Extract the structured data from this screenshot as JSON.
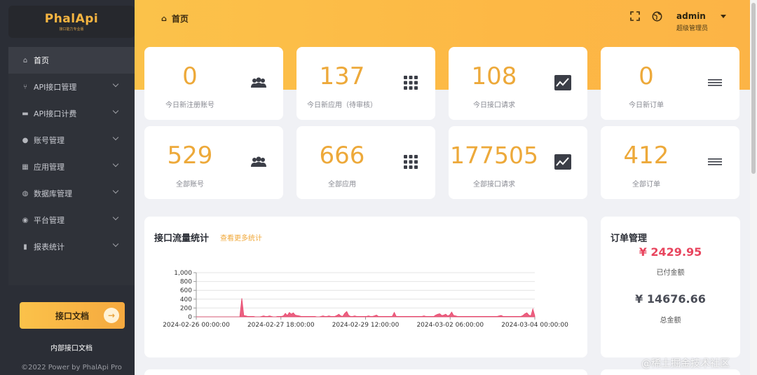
{
  "sidebar": {
    "logo": "PhalApi",
    "logo_sub": "接口能力专业版",
    "items": [
      {
        "label": "首页",
        "icon": "home-icon",
        "glyph": "⌂"
      },
      {
        "label": "API接口管理",
        "icon": "branch-icon",
        "glyph": "⑂"
      },
      {
        "label": "API接口计费",
        "icon": "card-icon",
        "glyph": "▬"
      },
      {
        "label": "账号管理",
        "icon": "user-icon",
        "glyph": "●"
      },
      {
        "label": "应用管理",
        "icon": "grid-icon",
        "glyph": "▦"
      },
      {
        "label": "数据库管理",
        "icon": "database-icon",
        "glyph": "◍"
      },
      {
        "label": "平台管理",
        "icon": "platform-icon",
        "glyph": "◉"
      },
      {
        "label": "报表统计",
        "icon": "barchart-icon",
        "glyph": "▮"
      }
    ],
    "doc_button": "接口文档",
    "internal_doc": "内部接口文档",
    "copyright": "©2022 Power by PhalApi Pro"
  },
  "header": {
    "breadcrumb": "首页",
    "user_name": "admin",
    "user_role": "超级管理员"
  },
  "stats_today": [
    {
      "value": "0",
      "label": "今日新注册账号",
      "icon": "users-icon"
    },
    {
      "value": "137",
      "label": "今日新应用（待审核）",
      "icon": "apps-grid-icon"
    },
    {
      "value": "108",
      "label": "今日接口请求",
      "icon": "trend-chart-icon"
    },
    {
      "value": "0",
      "label": "今日新订单",
      "icon": "list-lines-icon"
    }
  ],
  "stats_total": [
    {
      "value": "529",
      "label": "全部账号",
      "icon": "users-icon"
    },
    {
      "value": "666",
      "label": "全部应用",
      "icon": "apps-grid-icon"
    },
    {
      "value": "177505",
      "label": "全部接口请求",
      "icon": "trend-chart-icon"
    },
    {
      "value": "412",
      "label": "全部订单",
      "icon": "list-lines-icon"
    }
  ],
  "traffic": {
    "title": "接口流量统计",
    "more_link": "查看更多统计"
  },
  "orders": {
    "title": "订单管理",
    "paid_amount": "¥ 2429.95",
    "paid_label": "已付金额",
    "total_amount": "¥ 14676.66",
    "total_label": "总金额"
  },
  "watermark": "@稀土掘金技术社区",
  "chart_data": {
    "type": "area",
    "title": "",
    "xlabel": "",
    "ylabel": "",
    "ylim": [
      0,
      1000
    ],
    "y_ticks": [
      "0",
      "200",
      "400",
      "600",
      "800",
      "1,000"
    ],
    "x_ticks": [
      "2024-02-26 00:00:00",
      "2024-02-27 18:00:00",
      "2024-02-29 12:00:00",
      "2024-03-02 06:00:00",
      "2024-03-04 00:00:00"
    ],
    "series_color": "#e8456b",
    "values": [
      0,
      0,
      0,
      0,
      0,
      0,
      0,
      0,
      0,
      0,
      0,
      0,
      0,
      0,
      0,
      0,
      0,
      0,
      0,
      0,
      0,
      0,
      0,
      420,
      30,
      20,
      10,
      10,
      10,
      10,
      0,
      0,
      0,
      10,
      20,
      10,
      10,
      20,
      10,
      0,
      0,
      10,
      10,
      10,
      20,
      80,
      30,
      100,
      60,
      90,
      40,
      30,
      20,
      10,
      10,
      10,
      10,
      10,
      10,
      10,
      10,
      0,
      0,
      10,
      20,
      10,
      10,
      20,
      10,
      10,
      10,
      30,
      60,
      20,
      10,
      80,
      120,
      30,
      10,
      10,
      20,
      10,
      10,
      10,
      10,
      10,
      10,
      20,
      10,
      10,
      20,
      40,
      10,
      10,
      10,
      10,
      10,
      10,
      10,
      10,
      100,
      10,
      10,
      10,
      10,
      10,
      10,
      10,
      10,
      10,
      10,
      10,
      10,
      10,
      10,
      20,
      10,
      10,
      10,
      10,
      10,
      40,
      60,
      70,
      30,
      40,
      60,
      20,
      40,
      110,
      30,
      20,
      10,
      10,
      10,
      10,
      10,
      10,
      10,
      10,
      10,
      10,
      10,
      10,
      10,
      10,
      10,
      10,
      10,
      10,
      10,
      10,
      10,
      20,
      30,
      10,
      10,
      10,
      10,
      10,
      10,
      10,
      10,
      10,
      10,
      30,
      70,
      90,
      40,
      20,
      180,
      20
    ]
  }
}
